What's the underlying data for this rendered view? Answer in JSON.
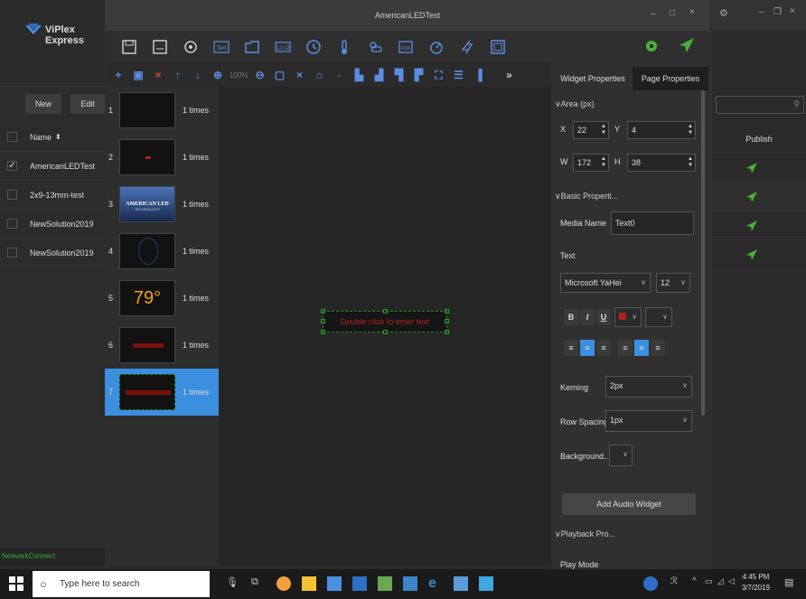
{
  "app": {
    "window_title": "AmericanLEDTest",
    "brand": "ViPlex Express"
  },
  "toolbar2": {
    "zoom": "100%"
  },
  "solutions": {
    "new_label": "New",
    "edit_label": "Edit",
    "name_header": "Name",
    "sort_glyph": "⬍",
    "checkmark": "✓",
    "rows": [
      {
        "name": "AmericanLEDTest",
        "checked": true
      },
      {
        "name": "2x9-13mm-test",
        "checked": false
      },
      {
        "name": "NewSolution2019",
        "checked": false
      },
      {
        "name": "NewSolution2019",
        "checked": false
      }
    ]
  },
  "status": "NetworkConnect",
  "pages": [
    {
      "num": "1",
      "times": "1 times"
    },
    {
      "num": "2",
      "times": "1 times"
    },
    {
      "num": "3",
      "times": "1 times",
      "logo_text": "AMERICAN LED",
      "logo_sub": "TECHNOLOGY"
    },
    {
      "num": "4",
      "times": "1 times"
    },
    {
      "num": "5",
      "times": "1 times",
      "temp": "79°"
    },
    {
      "num": "6",
      "times": "1 times"
    },
    {
      "num": "7",
      "times": "1 times",
      "selected": true
    }
  ],
  "canvas": {
    "text_widget": "Double click to enter text"
  },
  "props": {
    "tab_widget": "Widget Properties",
    "tab_page": "Page Properties",
    "area_title": "Area (px)",
    "x_label": "X",
    "x_value": "22",
    "y_label": "Y",
    "y_value": "4",
    "w_label": "W",
    "w_value": "172",
    "h_label": "H",
    "h_value": "38",
    "basic_title": "Basic Properti...",
    "media_name_label": "Media Name",
    "media_name_value": "Text0",
    "text_label": "Text",
    "font": "Microsoft YaHei",
    "font_size": "12",
    "bold": "B",
    "italic": "I",
    "underline": "U",
    "kerning_label": "Kerning",
    "kerning_value": "2px",
    "row_spacing_label": "Row Spacing",
    "row_spacing_value": "1px",
    "background_label": "Background...",
    "add_audio": "Add Audio Widget",
    "playback_title": "Playback Pro...",
    "play_mode_label": "Play Mode"
  },
  "right": {
    "publish_header": "Publish"
  },
  "taskbar": {
    "search_placeholder": "Type here to search",
    "time": "4:45 PM",
    "date": "3/7/2019"
  },
  "colors": {
    "accent": "#3c8ede",
    "green": "#4caf3a",
    "led_red": "#b3201e"
  }
}
